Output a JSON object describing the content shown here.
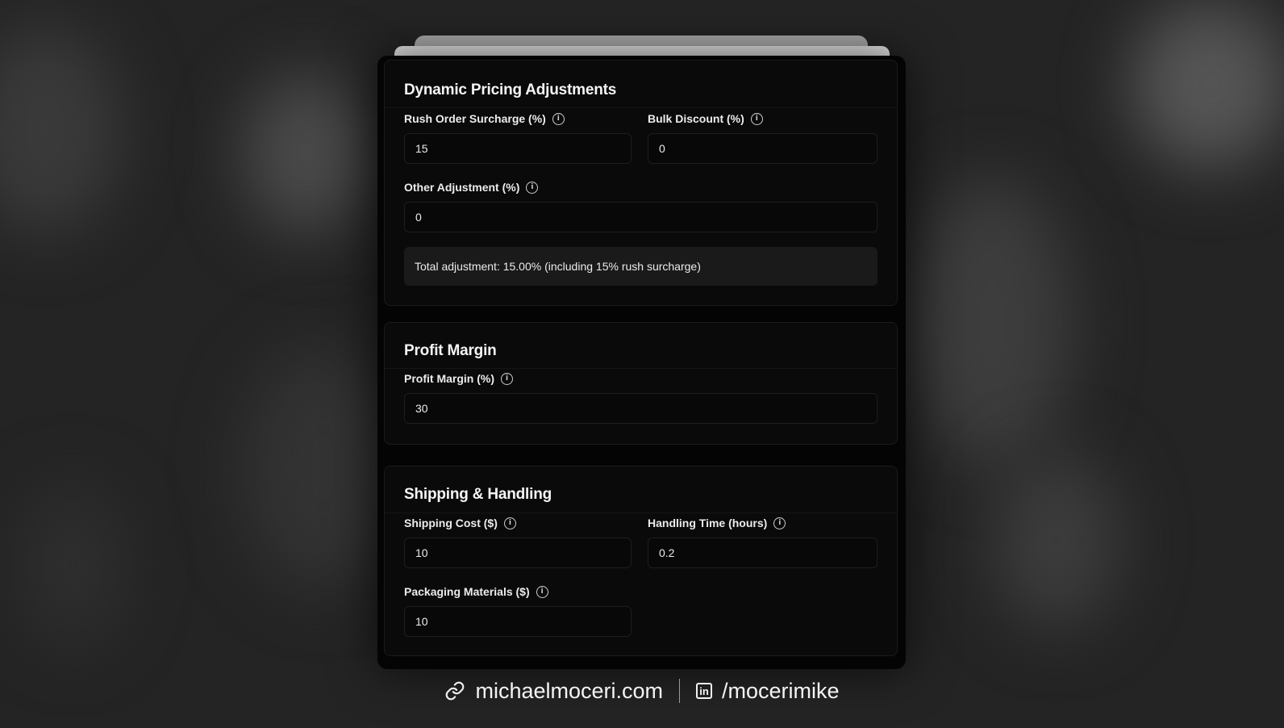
{
  "sections": {
    "dynamic_pricing": {
      "title": "Dynamic Pricing Adjustments",
      "rush_label": "Rush Order Surcharge (%)",
      "rush_value": "15",
      "bulk_label": "Bulk Discount (%)",
      "bulk_value": "0",
      "other_label": "Other Adjustment (%)",
      "other_value": "0",
      "summary": "Total adjustment: 15.00% (including 15% rush surcharge)"
    },
    "profit_margin": {
      "title": "Profit Margin",
      "margin_label": "Profit Margin (%)",
      "margin_value": "30"
    },
    "shipping": {
      "title": "Shipping & Handling",
      "shipping_label": "Shipping Cost ($)",
      "shipping_value": "10",
      "handling_label": "Handling Time (hours)",
      "handling_value": "0.2",
      "packaging_label": "Packaging Materials ($)",
      "packaging_value": "10"
    }
  },
  "icons": {
    "info": "info-icon",
    "link": "link-icon",
    "linkedin": "linkedin-icon"
  },
  "info_glyph": "i",
  "footer": {
    "website": "michaelmoceri.com",
    "linkedin_glyph": "in",
    "linkedin": "/mocerimike"
  }
}
